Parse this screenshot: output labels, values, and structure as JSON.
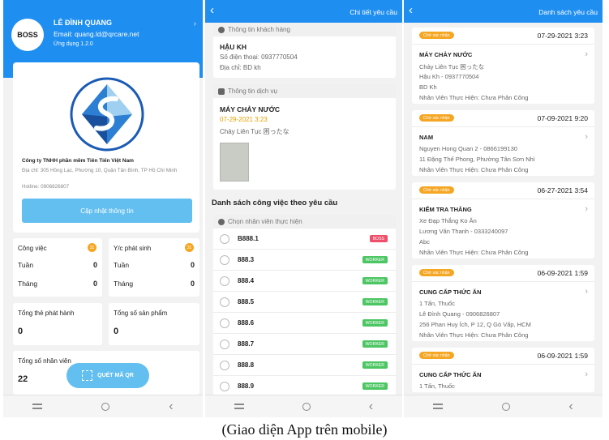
{
  "screen1": {
    "avatar": "BOSS",
    "user_name": "LÊ ĐÌNH QUANG",
    "email": "Email: quang.ld@qrcare.net",
    "app_version": "Ứng dụng 1.2.0",
    "company": {
      "name": "Công ty TNHH phần mềm Tiên Tiến Việt Nam",
      "address": "Địa chỉ: 305 Hồng Lạc, Phường 10, Quận Tân Bình, TP Hồ Chí Minh",
      "hotline": "Hotline: 0906826807",
      "update_button": "Cập nhật thông tin"
    },
    "stats": {
      "jobs": {
        "title": "Công việc",
        "badge": "31",
        "week_label": "Tuần",
        "week_value": "0",
        "month_label": "Tháng",
        "month_value": "0"
      },
      "requests": {
        "title": "Y/c phát sinh",
        "badge": "31",
        "week_label": "Tuần",
        "week_value": "0",
        "month_label": "Tháng",
        "month_value": "0"
      },
      "cards_issued": {
        "title": "Tổng thẻ phát hành",
        "value": "0"
      },
      "products": {
        "title": "Tổng số sản phẩm",
        "value": "0"
      },
      "employees": {
        "title": "Tổng số nhân viên",
        "value": "22"
      }
    },
    "scan_button": "QUÉT MÃ QR"
  },
  "screen2": {
    "title": "Chi tiết yêu cầu",
    "customer": {
      "header": "Thông tin khách hàng",
      "name": "HẬU KH",
      "phone": "Số điện thoại: 0937770504",
      "address": "Địa chỉ: BD kh"
    },
    "service": {
      "header": "Thông tin dịch vụ",
      "name": "MÁY CHẢY NƯỚC",
      "date": "07-29-2021 3:23",
      "note": "Chảy Liên Tục 困ったな"
    },
    "list_title": "Danh sách công việc theo yêu cầu",
    "select_header": "Chọn nhân viên thực hiện",
    "employees": [
      {
        "name": "B888.1",
        "role": "BOSS",
        "color": "#ef4f6a"
      },
      {
        "name": "888.3",
        "role": "WORKER",
        "color": "#4cc663"
      },
      {
        "name": "888.4",
        "role": "WORKER",
        "color": "#4cc663"
      },
      {
        "name": "888.5",
        "role": "WORKER",
        "color": "#4cc663"
      },
      {
        "name": "888.6",
        "role": "WORKER",
        "color": "#4cc663"
      },
      {
        "name": "888.7",
        "role": "WORKER",
        "color": "#4cc663"
      },
      {
        "name": "888.8",
        "role": "WORKER",
        "color": "#4cc663"
      },
      {
        "name": "888.9",
        "role": "WORKER",
        "color": "#4cc663"
      }
    ]
  },
  "screen3": {
    "title": "Danh sách yêu cầu",
    "requests": [
      {
        "status": "Chờ xác nhận",
        "date": "07-29-2021 3:23",
        "title": "MÁY CHẢY NƯỚC",
        "lines": [
          "Chảy Liên Tục 困ったな",
          "Hậu Kh - 0937770504",
          "BD Kh",
          "Nhân Viên Thực Hiện: Chưa Phân Công"
        ]
      },
      {
        "status": "Chờ xác nhận",
        "date": "07-09-2021 9:20",
        "title": "NAM",
        "lines": [
          "Nguyen Hong Quan 2 - 0866199130",
          "11 Đặng Thế Phong, Phường Tân Sơn Nhì",
          "Nhân Viên Thực Hiện: Chưa Phân Công"
        ]
      },
      {
        "status": "Chờ xác nhận",
        "date": "06-27-2021 3:54",
        "title": "KIỂM TRA THẮNG",
        "lines": [
          "Xe Đạp Thắng Ko Ăn",
          "Lương Văn Thanh - 0333240097",
          "Abc",
          "Nhân Viên Thực Hiện: Chưa Phân Công"
        ]
      },
      {
        "status": "Chờ xác nhận",
        "date": "06-09-2021 1:59",
        "title": "CUNG CẤP THỨC ĂN",
        "lines": [
          "1 Tấn, Thuốc",
          "Lê Đình Quang - 0906826807",
          "256 Phan Huy Ích, P 12, Q Gò Vấp, HCM",
          "Nhân Viên Thực Hiện: Chưa Phân Công"
        ]
      },
      {
        "status": "Chờ xác nhận",
        "date": "06-09-2021 1:59",
        "title": "CUNG CẤP THỨC ĂN",
        "lines": [
          "1 Tấn, Thuốc"
        ]
      }
    ]
  },
  "caption": "(Giao diện App trên mobile)",
  "colors": {
    "primary": "#1f8ef1",
    "button": "#63bff0",
    "badge": "#f5a623",
    "boss_tag": "#ef4f6a",
    "worker_tag": "#4cc663",
    "date_accent": "#e8a000"
  }
}
